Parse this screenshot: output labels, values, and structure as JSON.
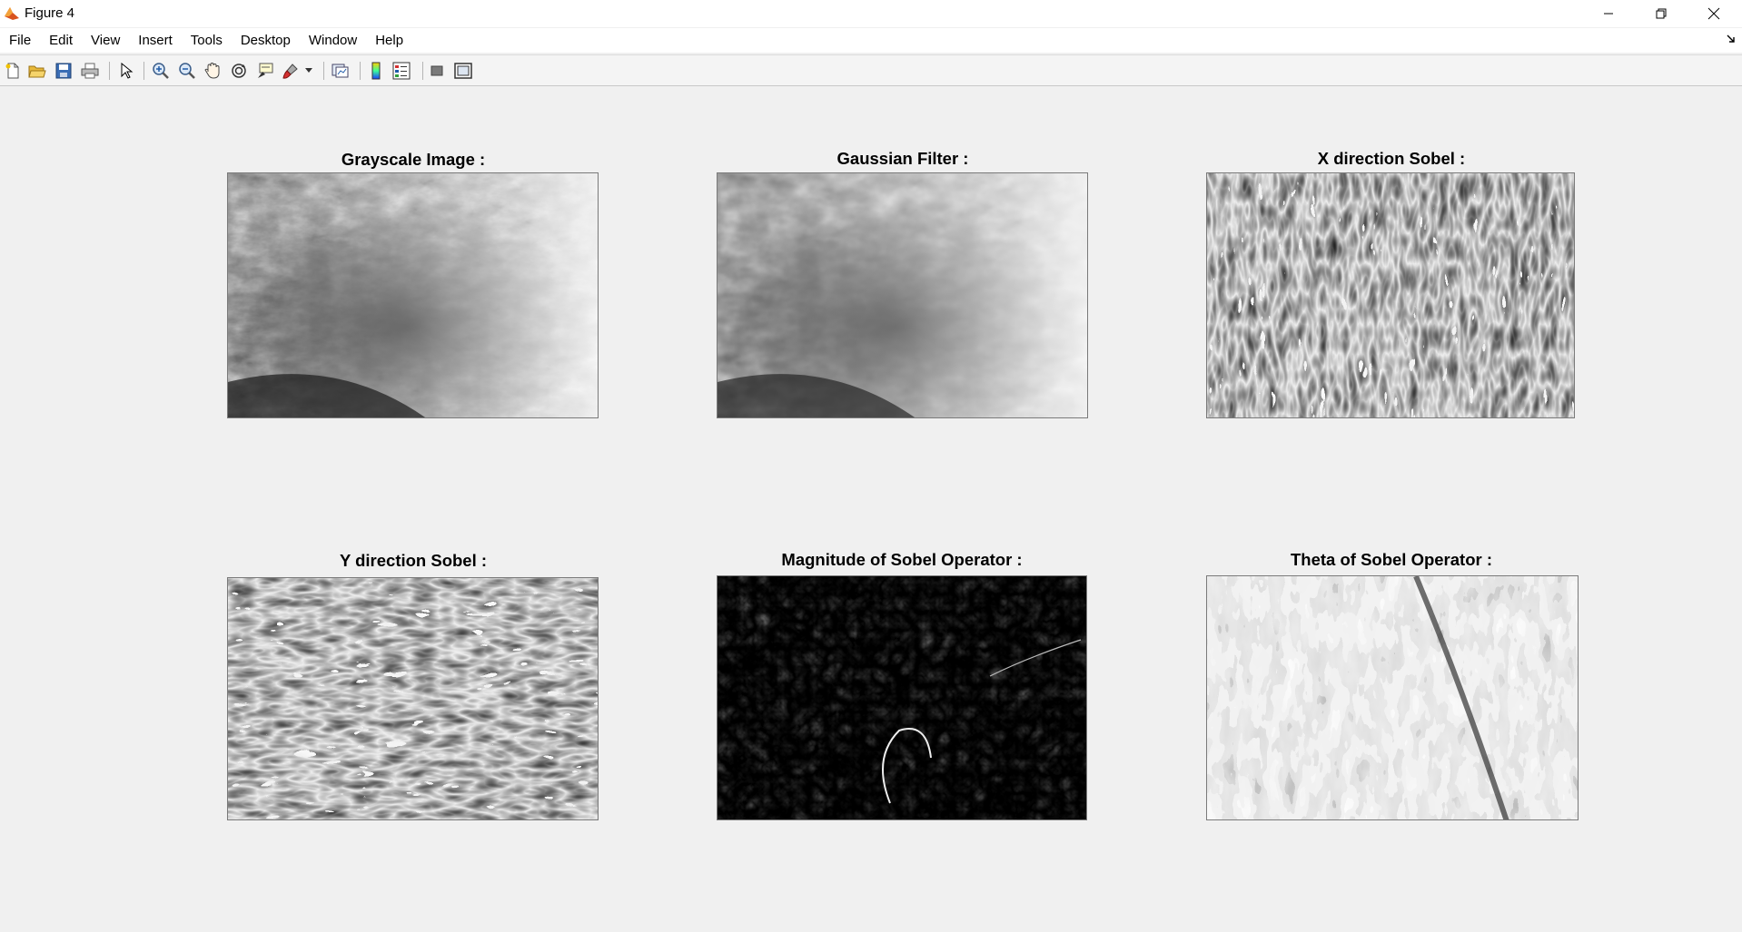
{
  "window": {
    "title": "Figure 4",
    "icon": "matlab-icon"
  },
  "menu": [
    "File",
    "Edit",
    "View",
    "Insert",
    "Tools",
    "Desktop",
    "Window",
    "Help"
  ],
  "toolbar": {
    "icons": [
      "new-figure-icon",
      "open-file-icon",
      "save-icon",
      "print-icon",
      "edit-plot-icon",
      "zoom-in-icon",
      "zoom-out-icon",
      "pan-icon",
      "rotate-3d-icon",
      "data-cursor-icon",
      "brush-icon",
      "link-plot-icon",
      "insert-colorbar-icon",
      "insert-legend-icon",
      "hide-plot-tools-icon",
      "show-plot-tools-icon"
    ]
  },
  "subplots": [
    {
      "title": "Grayscale Image :"
    },
    {
      "title": "Gaussian Filter :"
    },
    {
      "title": "X direction Sobel :"
    },
    {
      "title": "Y direction Sobel :"
    },
    {
      "title": "Magnitude of Sobel Operator :"
    },
    {
      "title": "Theta of Sobel Operator :"
    }
  ]
}
